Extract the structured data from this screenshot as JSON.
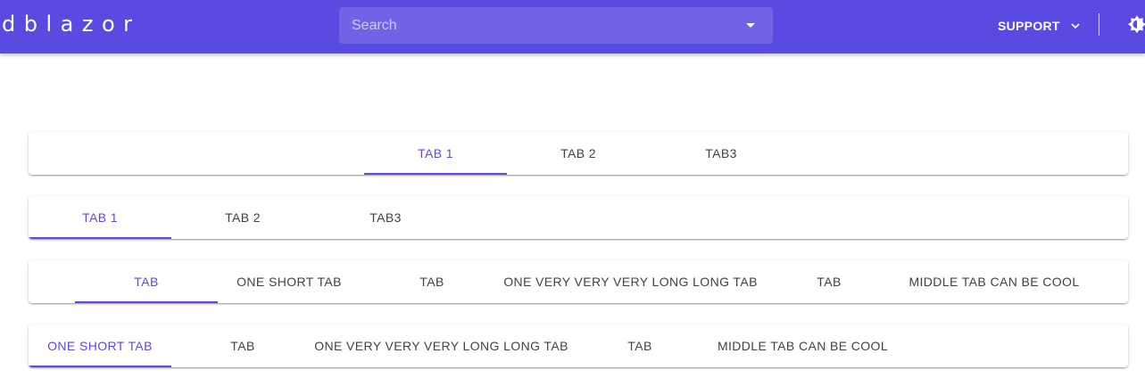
{
  "appbar": {
    "brand": "dblazor",
    "search_placeholder": "Search",
    "support_label": "SUPPORT"
  },
  "icons": {
    "dropdown": "arrow-drop-down-icon",
    "support_chevron": "chevron-down-icon",
    "theme": "brightness-icon"
  },
  "colors": {
    "primary": "#594ae2",
    "text": "#424242",
    "surface": "#ffffff"
  },
  "tab_groups": [
    {
      "alignment": "center",
      "tabs": [
        "TAB 1",
        "TAB 2",
        "TAB3"
      ],
      "active": 0
    },
    {
      "alignment": "start",
      "tabs": [
        "TAB 1",
        "TAB 2",
        "TAB3"
      ],
      "active": 0
    },
    {
      "alignment": "center",
      "tabs": [
        "TAB",
        "ONE SHORT TAB",
        "TAB",
        "ONE VERY VERY VERY LONG LONG TAB",
        "TAB",
        "MIDDLE TAB CAN BE COOL"
      ],
      "active": 0
    },
    {
      "alignment": "start",
      "tabs": [
        "ONE SHORT TAB",
        "TAB",
        "ONE VERY VERY VERY LONG LONG TAB",
        "TAB",
        "MIDDLE TAB CAN BE COOL"
      ],
      "active": 0
    }
  ]
}
